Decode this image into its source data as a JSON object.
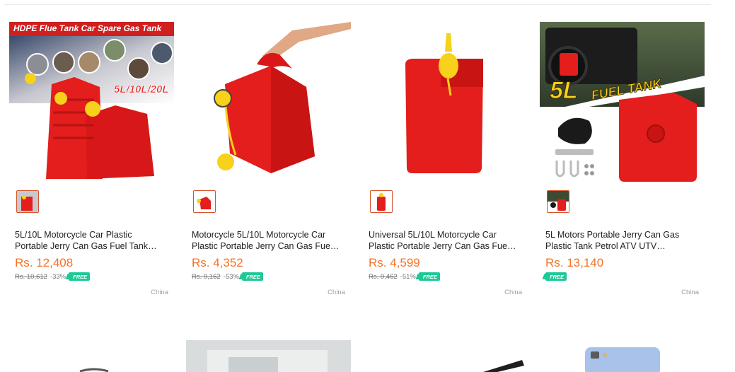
{
  "products": [
    {
      "title": "5L/10L Motorcycle Car Plastic Portable Jerry Can Gas Fuel Tank Spare Container Oil Gasoline",
      "price": "Rs. 12,408",
      "original_price": "Rs. 10,612",
      "discount": "-33%",
      "free_badge": "FREE",
      "country": "China",
      "banner_title": "HDPE Flue Tank Car Spare Gas Tank",
      "banner_sizes": "5L/10L/20L"
    },
    {
      "title": "Motorcycle 5L/10L Motorcycle Car Plastic Portable Jerry Can Gas Fuel Tank Container",
      "price": "Rs. 4,352",
      "original_price": "Rs. 9,162",
      "discount": "-53%",
      "free_badge": "FREE",
      "country": "China"
    },
    {
      "title": "Universal 5L/10L Motorcycle Car Plastic Portable Jerry Can Gas Fuel Tank",
      "price": "Rs. 4,599",
      "original_price": "Rs. 9,462",
      "discount": "-51%",
      "free_badge": "FREE",
      "country": "China"
    },
    {
      "title": "5L Motors Portable Jerry Can Gas Plastic Tank Petrol ATV UTV Motorcycle Spare",
      "price": "Rs. 13,140",
      "free_badge": "FREE",
      "country": "China",
      "banner_line1": "5L",
      "banner_line2": "FUEL TANK"
    }
  ],
  "colors": {
    "price": "#f57224",
    "free_badge": "#1ec996",
    "thumb_border": "#d4542b",
    "can_red": "#e41d1d",
    "cap_yellow": "#f7d11a"
  }
}
